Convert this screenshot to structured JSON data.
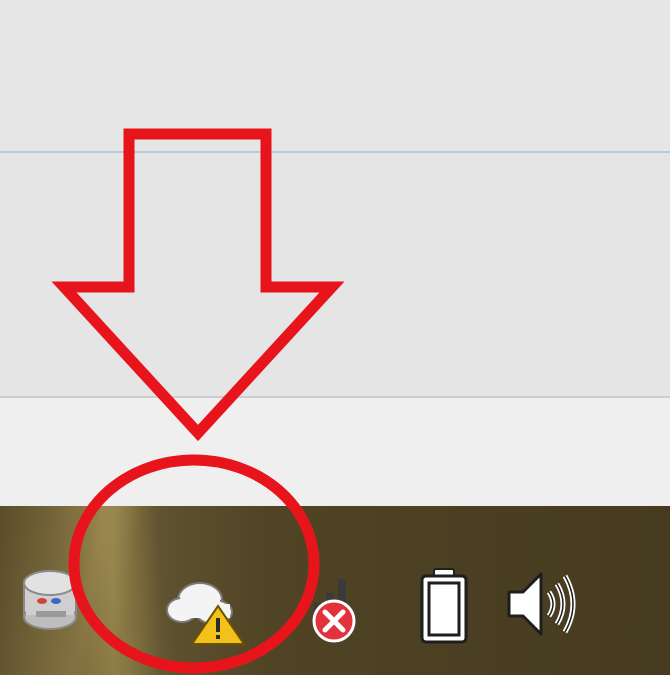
{
  "window": {
    "background_color": "#e6e6e6",
    "divider_color": "#b9c8da"
  },
  "taskbar": {
    "background_color": "#4a3f22",
    "tray_icons": [
      {
        "name": "removable-disk-icon"
      },
      {
        "name": "onedrive-warning-icon",
        "status": "warning"
      },
      {
        "name": "network-disconnected-icon",
        "status": "error"
      },
      {
        "name": "battery-icon"
      },
      {
        "name": "volume-icon"
      }
    ]
  },
  "annotation": {
    "color": "#e8141c",
    "shapes": [
      "down-arrow",
      "circle"
    ],
    "target": "onedrive-warning-icon"
  }
}
